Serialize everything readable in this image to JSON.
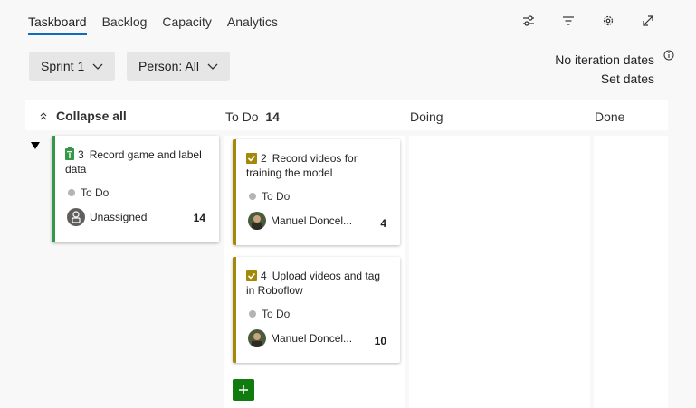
{
  "tabs": [
    {
      "label": "Taskboard",
      "active": true
    },
    {
      "label": "Backlog"
    },
    {
      "label": "Capacity"
    },
    {
      "label": "Analytics"
    }
  ],
  "toolbar": {
    "icons": [
      "settings-sliders-icon",
      "filter-icon",
      "gear-icon",
      "fullscreen-icon"
    ]
  },
  "filters": {
    "sprint": "Sprint 1",
    "person": "Person: All"
  },
  "iteration": {
    "no_dates": "No iteration dates",
    "set_dates": "Set dates"
  },
  "columns": {
    "collapse_all": "Collapse all",
    "todo": "To Do",
    "todo_count": "14",
    "doing": "Doing",
    "done": "Done"
  },
  "parent_card": {
    "id": "3",
    "title": "Record game and label data",
    "state": "To Do",
    "assignee": "Unassigned",
    "remaining": "14",
    "color": "#339947"
  },
  "tasks": [
    {
      "id": "2",
      "title": "Record videos for training the model",
      "state": "To Do",
      "assignee": "Manuel Doncel...",
      "remaining": "4",
      "color": "#a4880a"
    },
    {
      "id": "4",
      "title": "Upload videos and tag in Roboflow",
      "state": "To Do",
      "assignee": "Manuel Doncel...",
      "remaining": "10",
      "color": "#a4880a"
    }
  ]
}
